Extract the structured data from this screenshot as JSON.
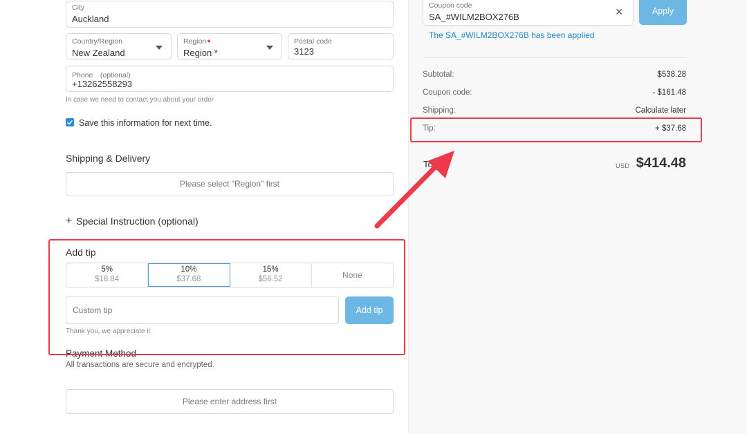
{
  "address": {
    "city": {
      "label": "City",
      "value": "Auckland"
    },
    "country": {
      "label": "Country/Region",
      "value": "New Zealand"
    },
    "region": {
      "label": "Region",
      "value": "Region *"
    },
    "postal": {
      "label": "Postal code",
      "value": "3123"
    },
    "phone": {
      "label": "Phone　(optional)",
      "value": "+13262558293"
    },
    "phone_helper": "In case we need to contact you about your order",
    "save_info": {
      "label": "Save this information for next time.",
      "checked": true
    }
  },
  "shipping": {
    "title": "Shipping & Delivery",
    "placeholder": "Please select \"Region\" first"
  },
  "special_instruction": {
    "icon": "plus-icon",
    "label": "Special Instruction (optional)"
  },
  "tip": {
    "title": "Add tip",
    "options": [
      {
        "percent": "5%",
        "amount": "$18.84"
      },
      {
        "percent": "10%",
        "amount": "$37.68",
        "selected": true
      },
      {
        "percent": "15%",
        "amount": "$56.52"
      }
    ],
    "none_label": "None",
    "custom_placeholder": "Custom tip",
    "add_button": "Add tip",
    "thanks": "Thank you, we appreciate it"
  },
  "payment": {
    "title": "Payment Method",
    "subtitle": "All transactions are secure and encrypted.",
    "placeholder": "Please enter address first"
  },
  "coupon": {
    "label": "Coupon code",
    "value": "SA_#WILM2BOX276B",
    "apply": "Apply",
    "applied_message": "The SA_#WILM2BOX276B has been applied"
  },
  "summary": {
    "subtotal": {
      "label": "Subtotal:",
      "value": "$538.28"
    },
    "coupon": {
      "label": "Coupon code:",
      "value": "- $161.48"
    },
    "shipping": {
      "label": "Shipping:",
      "value": "Calculate later"
    },
    "tip": {
      "label": "Tip:",
      "value": "+ $37.68"
    },
    "total": {
      "label": "Tot",
      "currency": "USD",
      "value": "$414.48"
    }
  },
  "colors": {
    "accent": "#6db7e4",
    "link": "#1e88c9",
    "highlight": "#ec3a48",
    "checkbox": "#2b8bd6"
  }
}
